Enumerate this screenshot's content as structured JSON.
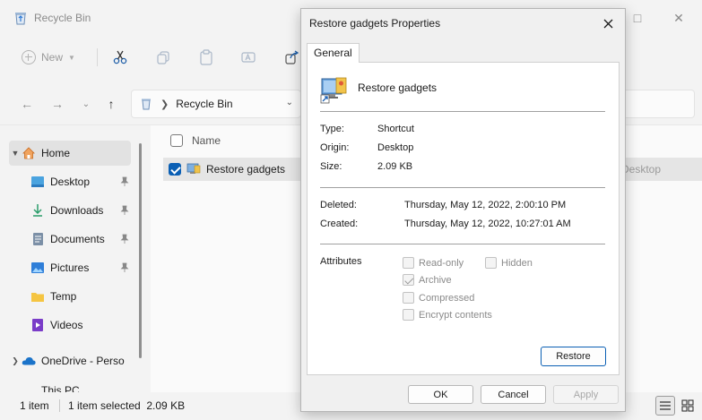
{
  "window": {
    "title": "Recycle Bin",
    "controls": {
      "minimize": "—",
      "maximize": "□",
      "close": "✕"
    }
  },
  "toolbar": {
    "new_label": "New",
    "icons": [
      "cut-icon",
      "copy-icon",
      "paste-icon",
      "rename-icon",
      "share-icon"
    ]
  },
  "address": {
    "crumb": "Recycle Bin"
  },
  "sidebar": {
    "items": [
      {
        "label": "Home",
        "icon": "home-icon"
      },
      {
        "label": "Desktop",
        "icon": "desktop-icon"
      },
      {
        "label": "Downloads",
        "icon": "downloads-icon"
      },
      {
        "label": "Documents",
        "icon": "documents-icon"
      },
      {
        "label": "Pictures",
        "icon": "pictures-icon"
      },
      {
        "label": "Temp",
        "icon": "folder-icon"
      },
      {
        "label": "Videos",
        "icon": "videos-icon"
      },
      {
        "label": "OneDrive - Perso",
        "icon": "onedrive-icon"
      },
      {
        "label": "This PC",
        "icon": "pc-icon"
      }
    ]
  },
  "filelist": {
    "column_name": "Name",
    "rows": [
      {
        "name": "Restore gadgets",
        "origin": "Desktop"
      }
    ]
  },
  "status": {
    "count": "1 item",
    "selection": "1 item selected  2.09 KB"
  },
  "dialog": {
    "title": "Restore gadgets Properties",
    "tab": "General",
    "object_name": "Restore gadgets",
    "props": {
      "type_label": "Type:",
      "type_value": "Shortcut",
      "origin_label": "Origin:",
      "origin_value": "Desktop",
      "size_label": "Size:",
      "size_value": "2.09 KB",
      "deleted_label": "Deleted:",
      "deleted_value": "Thursday, May 12, 2022, 2:00:10 PM",
      "created_label": "Created:",
      "created_value": "Thursday, May 12, 2022, 10:27:01 AM"
    },
    "attributes_label": "Attributes",
    "attributes": {
      "read_only": "Read-only",
      "hidden": "Hidden",
      "archive": "Archive",
      "compressed": "Compressed",
      "encrypt": "Encrypt contents"
    },
    "restore_label": "Restore",
    "ok_label": "OK",
    "cancel_label": "Cancel",
    "apply_label": "Apply"
  },
  "colors": {
    "accent": "#0a5fb4",
    "selected_row": "#e5e5e5"
  }
}
